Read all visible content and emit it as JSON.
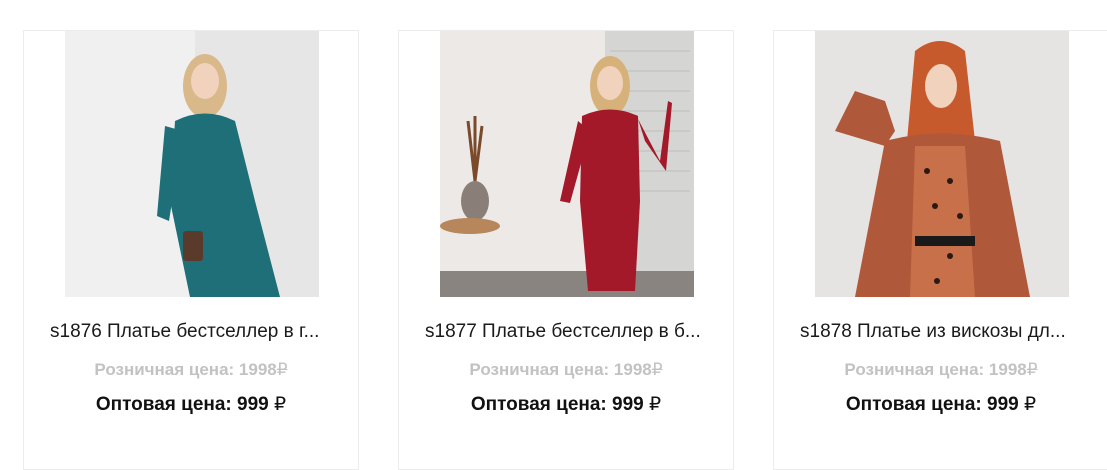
{
  "products": [
    {
      "title": "s1876 Платье бестселлер в г...",
      "retail_label": "Розничная цена: ",
      "retail_price": "1998",
      "wholesale_label": "Оптовая цена: ",
      "wholesale_price": "999 ",
      "currency": "₽",
      "colors": {
        "bg": "#e4e4e4",
        "dress": "#1e6f78",
        "hair": "#d9b98a"
      }
    },
    {
      "title": "s1877 Платье бестселлер в б...",
      "retail_label": "Розничная цена: ",
      "retail_price": "1998",
      "wholesale_label": "Оптовая цена: ",
      "wholesale_price": "999 ",
      "currency": "₽",
      "colors": {
        "bg": "#ebe9e6",
        "dress": "#a3192a",
        "hair": "#d6b27a"
      }
    },
    {
      "title": "s1878 Платье из вискозы дл...",
      "retail_label": "Розничная цена: ",
      "retail_price": "1998",
      "wholesale_label": "Оптовая цена: ",
      "wholesale_price": "999 ",
      "currency": "₽",
      "colors": {
        "bg": "#e6e4e2",
        "dress": "#b0583a",
        "hair": "#c65a2c"
      }
    }
  ]
}
